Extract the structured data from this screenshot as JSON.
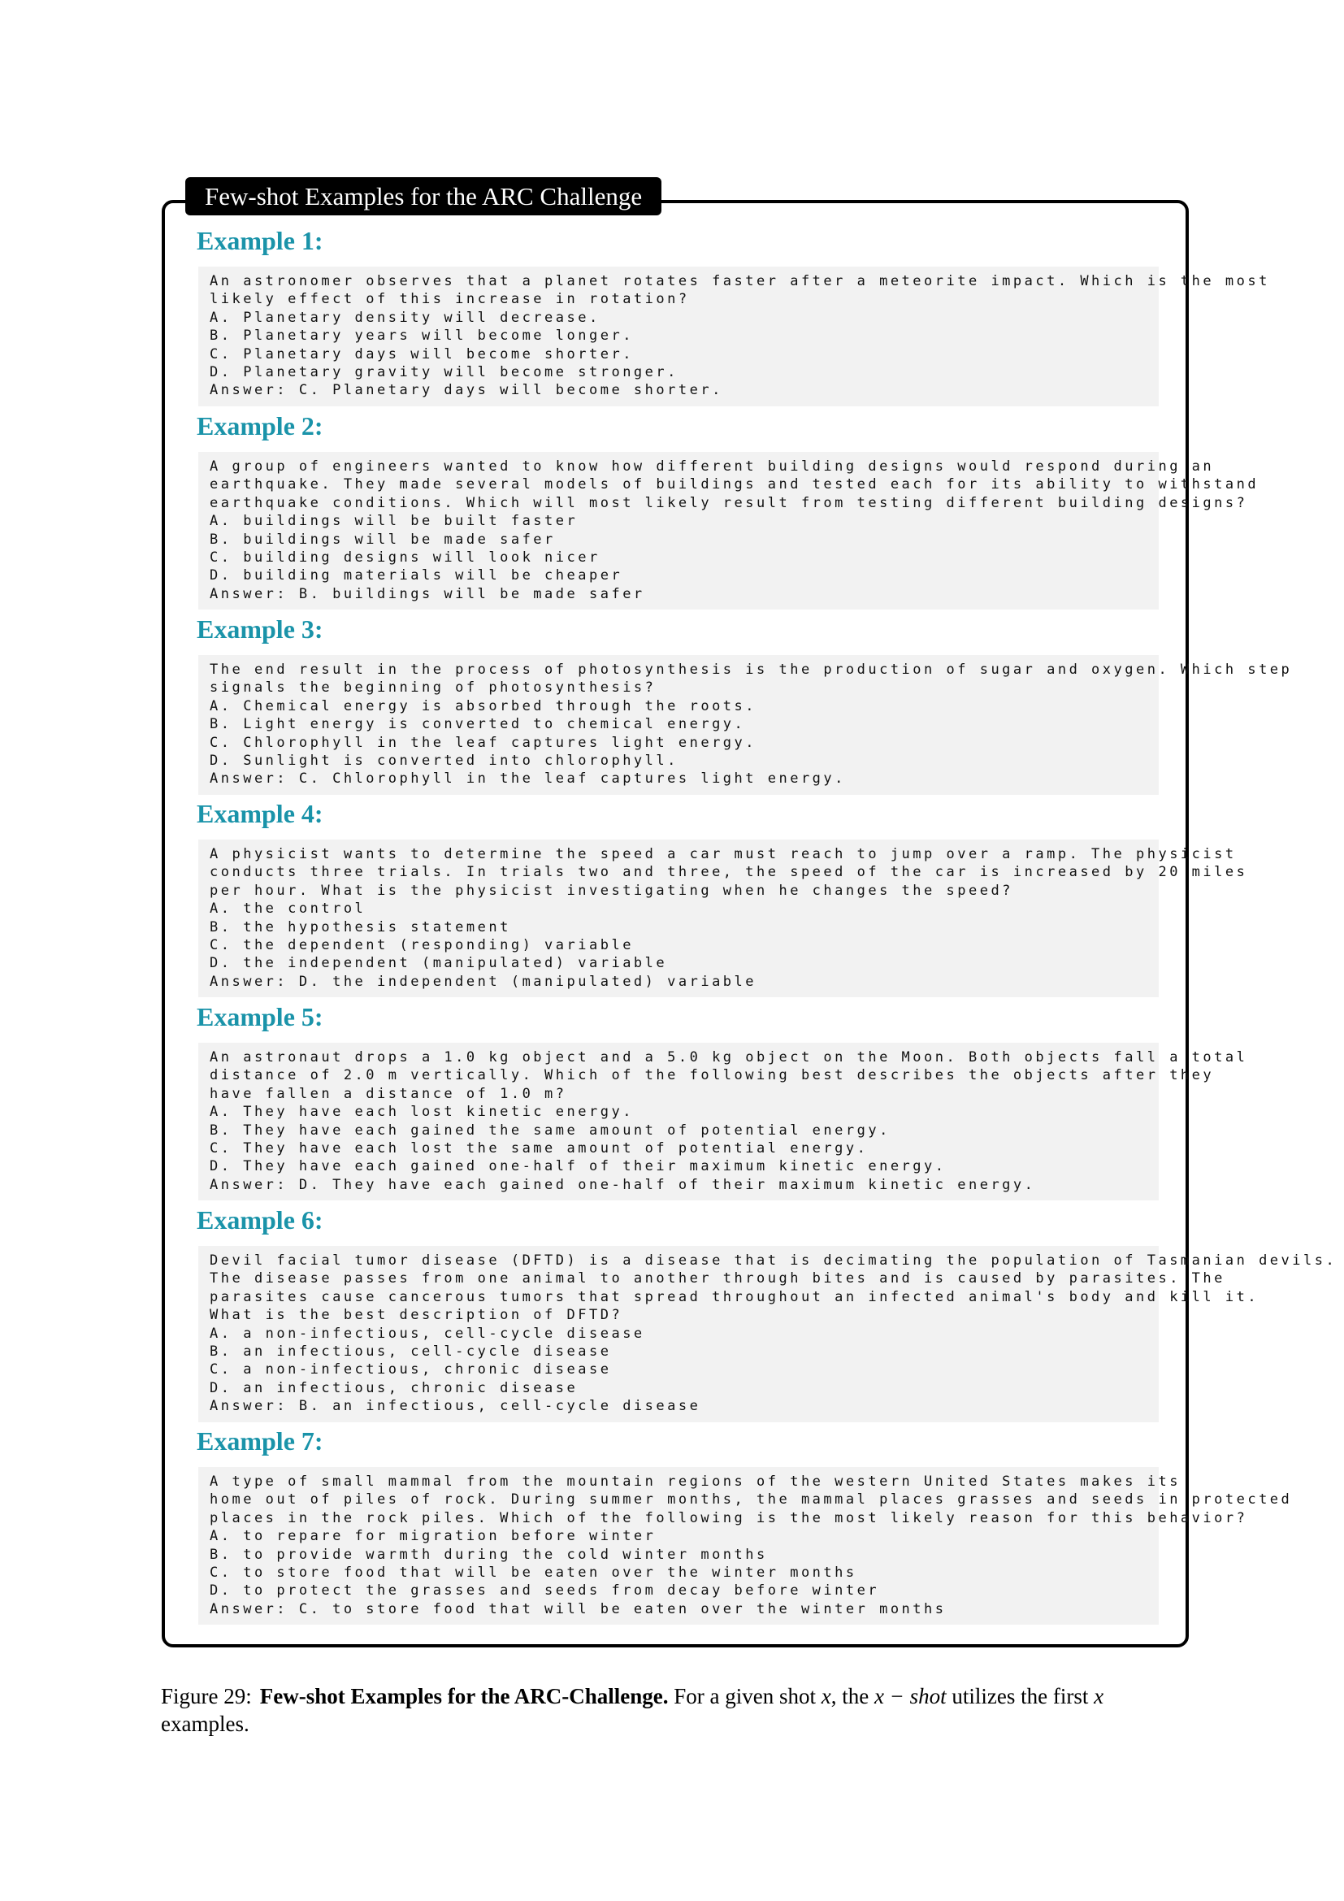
{
  "box_title": "Few-shot Examples for the ARC Challenge",
  "examples": [
    {
      "heading": "Example 1:",
      "lines": [
        "An astronomer observes that a planet rotates faster after a meteorite impact. Which is the most",
        "likely effect of this increase in rotation?",
        "A. Planetary density will decrease.",
        "B. Planetary years will become longer.",
        "C. Planetary days will become shorter.",
        "D. Planetary gravity will become stronger.",
        "Answer: C. Planetary days will become shorter."
      ]
    },
    {
      "heading": "Example 2:",
      "lines": [
        "A group of engineers wanted to know how different building designs would respond during an",
        "earthquake. They made several models of buildings and tested each for its ability to withstand",
        "earthquake conditions. Which will most likely result from testing different building designs?",
        "A. buildings will be built faster",
        "B. buildings will be made safer",
        "C. building designs will look nicer",
        "D. building materials will be cheaper",
        "Answer: B. buildings will be made safer"
      ]
    },
    {
      "heading": "Example 3:",
      "lines": [
        "The end result in the process of photosynthesis is the production of sugar and oxygen. Which step",
        "signals the beginning of photosynthesis?",
        "A. Chemical energy is absorbed through the roots.",
        "B. Light energy is converted to chemical energy.",
        "C. Chlorophyll in the leaf captures light energy.",
        "D. Sunlight is converted into chlorophyll.",
        "Answer: C. Chlorophyll in the leaf captures light energy."
      ]
    },
    {
      "heading": "Example 4:",
      "lines": [
        "A physicist wants to determine the speed a car must reach to jump over a ramp. The physicist",
        "conducts three trials. In trials two and three, the speed of the car is increased by 20 miles",
        "per hour. What is the physicist investigating when he changes the speed?",
        "A. the control",
        "B. the hypothesis statement",
        "C. the dependent (responding) variable",
        "D. the independent (manipulated) variable",
        "Answer: D. the independent (manipulated) variable"
      ]
    },
    {
      "heading": "Example 5:",
      "lines": [
        "An astronaut drops a 1.0 kg object and a 5.0 kg object on the Moon. Both objects fall a total",
        "distance of 2.0 m vertically. Which of the following best describes the objects after they",
        "have fallen a distance of 1.0 m?",
        "A. They have each lost kinetic energy.",
        "B. They have each gained the same amount of potential energy.",
        "C. They have each lost the same amount of potential energy.",
        "D. They have each gained one-half of their maximum kinetic energy.",
        "Answer: D. They have each gained one-half of their maximum kinetic energy."
      ]
    },
    {
      "heading": "Example 6:",
      "lines": [
        "Devil facial tumor disease (DFTD) is a disease that is decimating the population of Tasmanian devils.",
        "The disease passes from one animal to another through bites and is caused by parasites. The",
        "parasites cause cancerous tumors that spread throughout an infected animal's body and kill it.",
        "What is the best description of DFTD?",
        "A. a non-infectious, cell-cycle disease",
        "B. an infectious, cell-cycle disease",
        "C. a non-infectious, chronic disease",
        "D. an infectious, chronic disease",
        "Answer: B. an infectious, cell-cycle disease"
      ]
    },
    {
      "heading": "Example 7:",
      "lines": [
        "A type of small mammal from the mountain regions of the western United States makes its",
        "home out of piles of rock. During summer months, the mammal places grasses and seeds in protected",
        "places in the rock piles. Which of the following is the most likely reason for this behavior?",
        "A. to repare for migration before winter",
        "B. to provide warmth during the cold winter months",
        "C. to store food that will be eaten over the winter months",
        "D. to protect the grasses and seeds from decay before winter",
        "Answer: C. to store food that will be eaten over the winter months"
      ]
    }
  ],
  "caption": {
    "label": "Figure 29:",
    "bold": "Few-shot Examples for the ARC-Challenge.",
    "text_1": "For a given shot ",
    "var_1": "x",
    "text_2": ", the ",
    "var_2": "x − shot",
    "text_3": " utilizes the first ",
    "var_3": "x",
    "text_4": " examples."
  }
}
